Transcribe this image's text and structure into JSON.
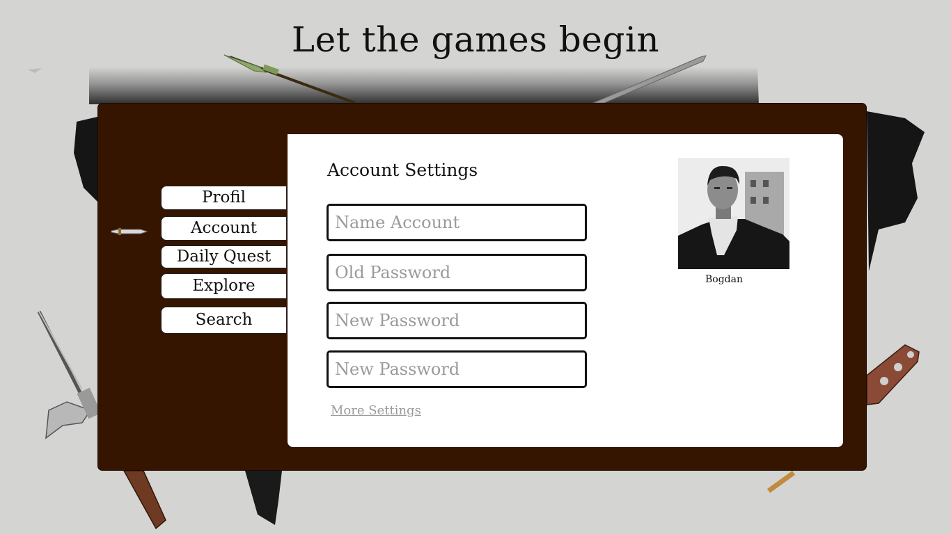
{
  "header": {
    "title": "Let the games begin"
  },
  "nav": {
    "items": [
      {
        "label": "Profil"
      },
      {
        "label": "Account"
      },
      {
        "label": "Daily Quest"
      },
      {
        "label": "Explore"
      },
      {
        "label": "Search"
      }
    ],
    "active_index": 1,
    "active_marker_icon": "dagger-icon"
  },
  "settings": {
    "title": "Account Settings",
    "fields": [
      {
        "placeholder": "Name Account",
        "value": ""
      },
      {
        "placeholder": "Old Password",
        "value": ""
      },
      {
        "placeholder": "New Password",
        "value": ""
      },
      {
        "placeholder": "New Password",
        "value": ""
      }
    ],
    "more_link": "More Settings"
  },
  "profile": {
    "name": "Bogdan"
  },
  "colors": {
    "background": "#d4d4d2",
    "frame": "#351400",
    "panel": "#ffffff",
    "field_border": "#111111",
    "placeholder": "#9a9a9a"
  }
}
